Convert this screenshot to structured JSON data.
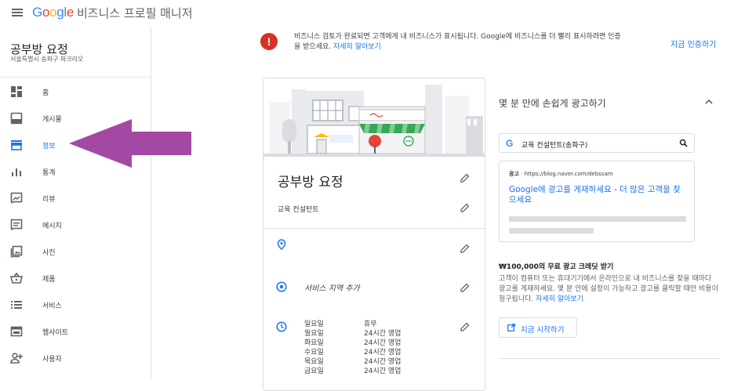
{
  "app": {
    "logo_parts": [
      "G",
      "o",
      "o",
      "g",
      "l",
      "e"
    ],
    "title": "비즈니스 프로필 매니저"
  },
  "sidebar": {
    "business_name": "공부방 요정",
    "business_address": "서울특별시 송파구 파크리오",
    "items": [
      {
        "label": "홈",
        "icon": "dashboard-icon"
      },
      {
        "label": "게시물",
        "icon": "posts-icon"
      },
      {
        "label": "정보",
        "icon": "store-icon",
        "active": true
      },
      {
        "label": "통계",
        "icon": "insights-icon"
      },
      {
        "label": "리뷰",
        "icon": "reviews-icon"
      },
      {
        "label": "메시지",
        "icon": "messages-icon"
      },
      {
        "label": "사진",
        "icon": "photos-icon"
      },
      {
        "label": "제품",
        "icon": "products-icon"
      },
      {
        "label": "서비스",
        "icon": "services-icon"
      },
      {
        "label": "웹사이트",
        "icon": "website-icon"
      },
      {
        "label": "사용자",
        "icon": "users-icon"
      }
    ]
  },
  "colors": {
    "accent": "#1a73e8",
    "alert_red": "#d93025",
    "annotation_arrow": "#a349a4"
  },
  "alert": {
    "text": "비즈니스 검토가 완료되면 고객에게 내 비즈니스가 표시됩니다. Google에 비즈니스를 더 빨리 표시하려면 인증을 받으세요.",
    "link": "자세히 알아보기",
    "action": "지금 인증하기"
  },
  "info_card": {
    "business_name": "공부방 요정",
    "category": "교육 컨설턴트",
    "service_area_placeholder": "서비스 지역 추가",
    "hours": [
      {
        "day": "일요일",
        "value": "휴무"
      },
      {
        "day": "월요일",
        "value": "24시간 영업"
      },
      {
        "day": "화요일",
        "value": "24시간 영업"
      },
      {
        "day": "수요일",
        "value": "24시간 영업"
      },
      {
        "day": "목요일",
        "value": "24시간 영업"
      },
      {
        "day": "금요일",
        "value": "24시간 영업"
      }
    ]
  },
  "ads_panel": {
    "title": "몇 분 만에 손쉽게 광고하기",
    "search_query": "교육 컨설턴트(송파구)",
    "ad_label": "광고",
    "ad_url": "https://blog.naver.com/debssam",
    "ad_headline": "Google에 광고를 게재하세요 - 더 많은 고객을 찾으세요",
    "credit_title": "₩100,000의 무료 광고 크레딧 받기",
    "credit_text": "고객이 컴퓨터 또는 휴대기기에서 온라인으로 내 비즈니스를 찾을 때마다 광고를 게재하세요. 몇 분 안에 설정이 가능하고 광고를 클릭할 때만 비용이 청구됩니다.",
    "credit_link": "자세히 알아보기",
    "start_button": "지금 시작하기"
  }
}
